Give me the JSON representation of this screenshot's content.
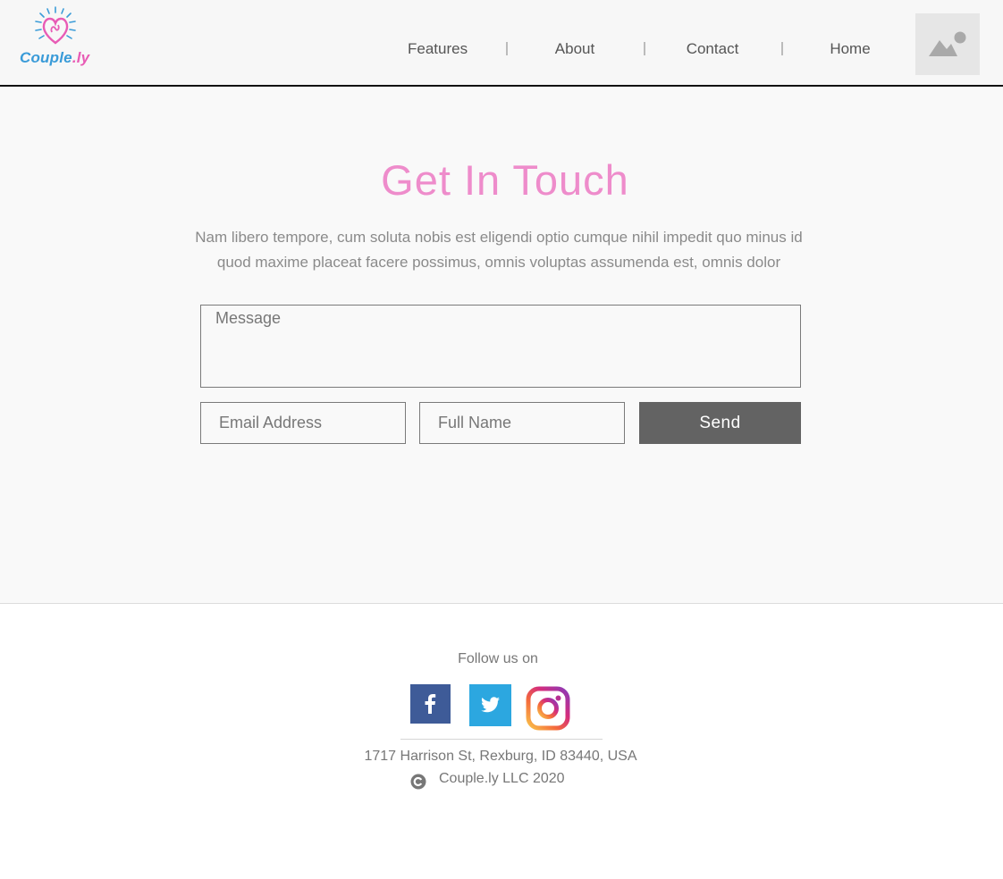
{
  "brand": {
    "name_part1": "Couple",
    "name_part2": ".ly"
  },
  "nav": {
    "items": [
      {
        "label": "Features"
      },
      {
        "label": "About"
      },
      {
        "label": "Contact"
      },
      {
        "label": "Home"
      }
    ]
  },
  "contact": {
    "title": "Get In Touch",
    "description": "Nam libero tempore, cum soluta nobis est eligendi optio cumque nihil impedit quo minus id quod maxime placeat facere possimus, omnis voluptas assumenda est, omnis dolor",
    "message_placeholder": "Message",
    "email_placeholder": "Email Address",
    "name_placeholder": "Full Name",
    "send_label": "Send"
  },
  "footer": {
    "follow_label": "Follow us on",
    "socials": [
      {
        "icon": "facebook-icon",
        "color": "#3e5b98"
      },
      {
        "icon": "twitter-icon",
        "color": "#2ca7e0"
      },
      {
        "icon": "instagram-icon",
        "color": "#c13584"
      }
    ],
    "address": "1717 Harrison St, Rexburg, ID 83440, USA",
    "copyright": "Couple.ly LLC 2020"
  },
  "colors": {
    "accent_pink": "#ee8ccb",
    "logo_blue": "#3a9bd8",
    "logo_pink": "#e85bb5",
    "send_button": "#636363"
  }
}
